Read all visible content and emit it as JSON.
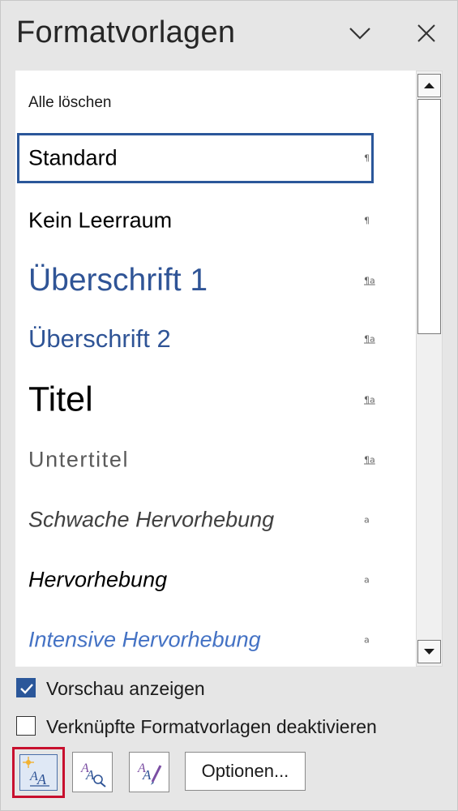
{
  "header": {
    "title": "Formatvorlagen",
    "chevron_icon": "chevron-down-icon",
    "close_icon": "close-icon"
  },
  "styles": {
    "clear_all": "Alle löschen",
    "items": [
      {
        "label": "Standard",
        "mark": "¶",
        "selected": true
      },
      {
        "label": "Kein Leerraum",
        "mark": "¶"
      },
      {
        "label": "Überschrift 1",
        "mark": "¶a"
      },
      {
        "label": "Überschrift 2",
        "mark": "¶a"
      },
      {
        "label": "Titel",
        "mark": "¶a"
      },
      {
        "label": "Untertitel",
        "mark": "¶a"
      },
      {
        "label": "Schwache Hervorhebung",
        "mark": "a"
      },
      {
        "label": "Hervorhebung",
        "mark": "a"
      },
      {
        "label": "Intensive Hervorhebung",
        "mark": "a"
      }
    ]
  },
  "options": {
    "preview_label": "Vorschau anzeigen",
    "preview_checked": true,
    "disable_linked_label": "Verknüpfte Formatvorlagen deaktivieren",
    "disable_linked_checked": false
  },
  "toolbar": {
    "new_style_icon": "new-style-icon",
    "style_inspector_icon": "style-inspector-icon",
    "manage_styles_icon": "manage-styles-icon",
    "options_label": "Optionen..."
  },
  "colors": {
    "accent": "#2b579a",
    "heading_blue": "#2f5496",
    "intensive_blue": "#4472c4",
    "highlight_red": "#c8102e"
  }
}
